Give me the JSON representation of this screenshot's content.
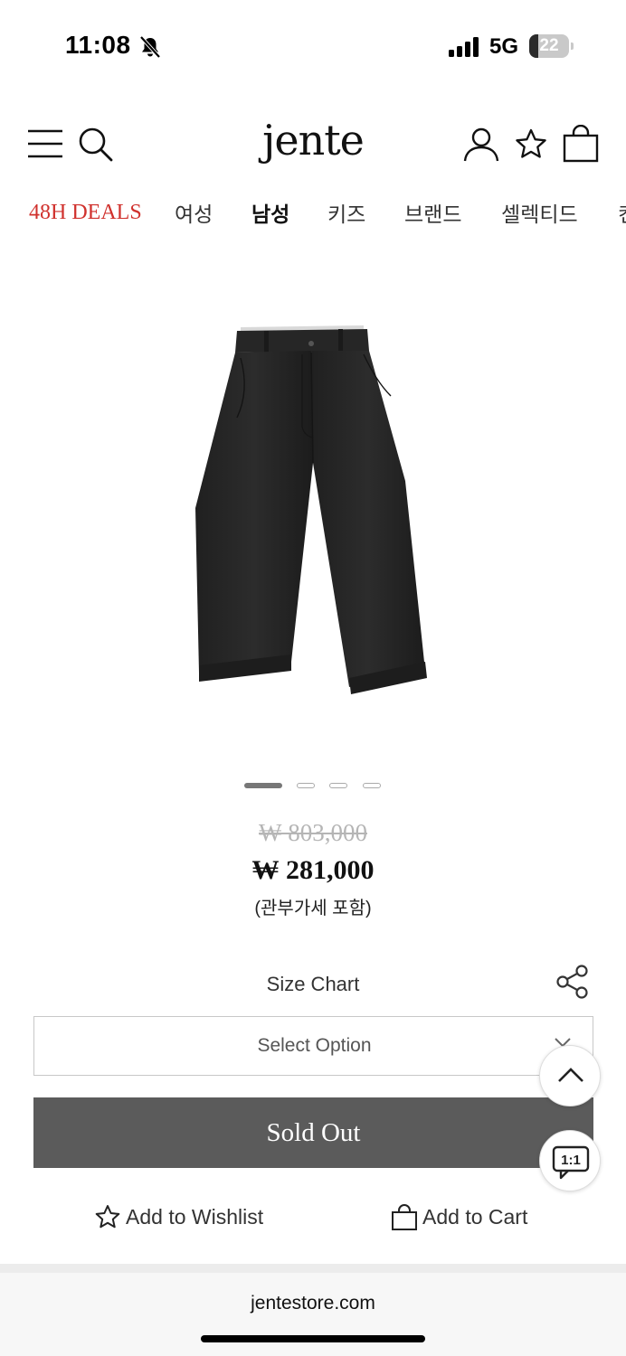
{
  "status_bar": {
    "time": "11:08",
    "network": "5G",
    "battery_level": "22",
    "battery_fraction": 0.22
  },
  "header": {
    "logo": "jente",
    "icons": [
      "menu-icon",
      "search-icon",
      "user-icon",
      "star-icon",
      "shopping-bag-icon"
    ]
  },
  "nav": {
    "items": [
      {
        "label": "48H DEALS"
      },
      {
        "label": "여성"
      },
      {
        "label": "남성"
      },
      {
        "label": "키즈"
      },
      {
        "label": "브랜드"
      },
      {
        "label": "셀렉티드"
      },
      {
        "label": "컨"
      }
    ],
    "active_index": 2
  },
  "product": {
    "image_alt_icon": "pants-image",
    "carousel": {
      "total": 4,
      "current": 1
    },
    "price_original": "₩ 803,000",
    "price_sale": "₩ 281,000",
    "price_note": "(관부가세 포함)"
  },
  "options": {
    "size_chart_label": "Size Chart",
    "select_placeholder": "Select Option",
    "sold_out_label": "Sold Out"
  },
  "actions": {
    "wishlist_label": "Add to Wishlist",
    "cart_label": "Add to Cart"
  },
  "floating": {
    "chat_label": "1:1"
  },
  "browser": {
    "url": "jentestore.com"
  },
  "colors": {
    "deals_accent": "#d0312d",
    "sold_out_bg": "#5b5b5b"
  }
}
